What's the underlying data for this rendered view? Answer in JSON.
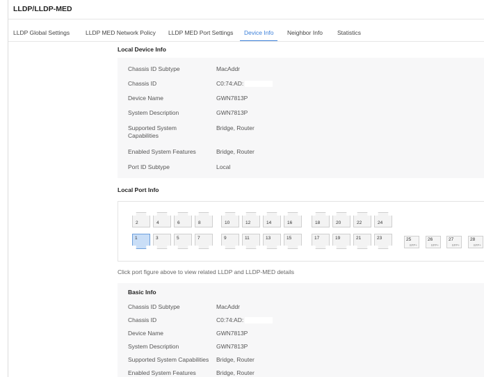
{
  "page": {
    "title": "LLDP/LLDP-MED"
  },
  "tabs": [
    {
      "label": "LLDP Global Settings"
    },
    {
      "label": "LLDP MED Network Policy"
    },
    {
      "label": "LLDP MED Port Settings"
    },
    {
      "label": "Device Info"
    },
    {
      "label": "Neighbor Info"
    },
    {
      "label": "Statistics"
    }
  ],
  "active_tab": "Device Info",
  "accent_color": "#3b7fd9",
  "local_device": {
    "title": "Local Device Info",
    "rows": [
      {
        "label": "Chassis ID Subtype",
        "value": "MacAddr"
      },
      {
        "label": "Chassis ID",
        "value": "C0:74:AD:"
      },
      {
        "label": "Device Name",
        "value": "GWN7813P"
      },
      {
        "label": "System Description",
        "value": "GWN7813P"
      },
      {
        "label": "Supported System Capabilities",
        "value": "Bridge, Router"
      },
      {
        "label": "Enabled System Features",
        "value": "Bridge, Router"
      },
      {
        "label": "Port ID Subtype",
        "value": "Local"
      }
    ]
  },
  "local_port": {
    "title": "Local Port Info",
    "top_ports": [
      "2",
      "4",
      "6",
      "8",
      "10",
      "12",
      "14",
      "16",
      "18",
      "20",
      "22",
      "24"
    ],
    "bottom_ports": [
      "1",
      "3",
      "5",
      "7",
      "9",
      "11",
      "13",
      "15",
      "17",
      "19",
      "21",
      "23"
    ],
    "selected_port": "1",
    "sfp_ports": [
      {
        "num": "25",
        "label": "SFP+"
      },
      {
        "num": "26",
        "label": "SFP+"
      },
      {
        "num": "27",
        "label": "SFP+"
      },
      {
        "num": "28",
        "label": "SFP+"
      }
    ],
    "hint": "Click port figure above to view related LLDP and LLDP-MED details"
  },
  "basic_info": {
    "title": "Basic Info",
    "rows": [
      {
        "label": "Chassis ID Subtype",
        "value": "MacAddr"
      },
      {
        "label": "Chassis ID",
        "value": "C0:74:AD:"
      },
      {
        "label": "Device Name",
        "value": "GWN7813P"
      },
      {
        "label": "System Description",
        "value": "GWN7813P"
      },
      {
        "label": "Supported System Capabilities",
        "value": "Bridge, Router"
      },
      {
        "label": "Enabled System Features",
        "value": "Bridge, Router"
      }
    ]
  }
}
